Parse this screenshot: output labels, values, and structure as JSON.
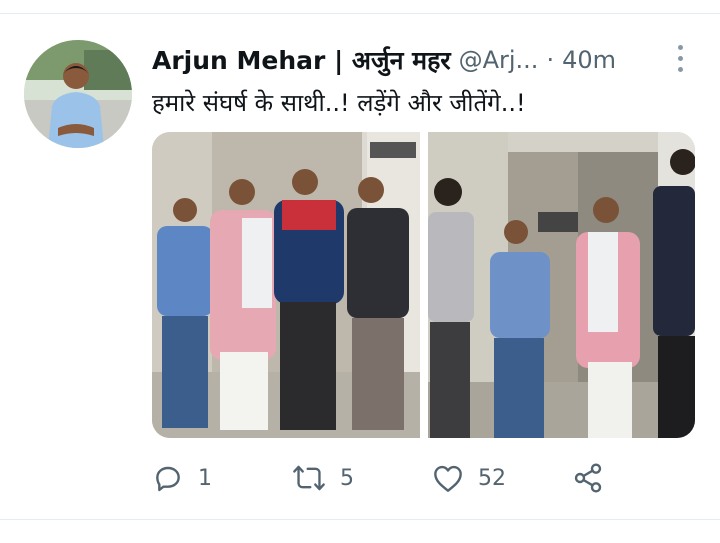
{
  "tweet": {
    "author_name": "Arjun Mehar | अर्जुन महर",
    "handle": "@Arj...",
    "separator": "·",
    "time": "40m",
    "text": "हमारे संघर्ष के साथी..! लड़ेंगे और जीतेंगे..!"
  },
  "icons": {
    "more": "more-vertical-icon",
    "reply": "reply-icon",
    "retweet": "retweet-icon",
    "like": "heart-icon",
    "share": "share-icon"
  },
  "actions": {
    "reply_count": "1",
    "retweet_count": "5",
    "like_count": "52"
  },
  "colors": {
    "text_primary": "#0f1419",
    "text_secondary": "#536471",
    "divider": "#e6ecf0"
  }
}
